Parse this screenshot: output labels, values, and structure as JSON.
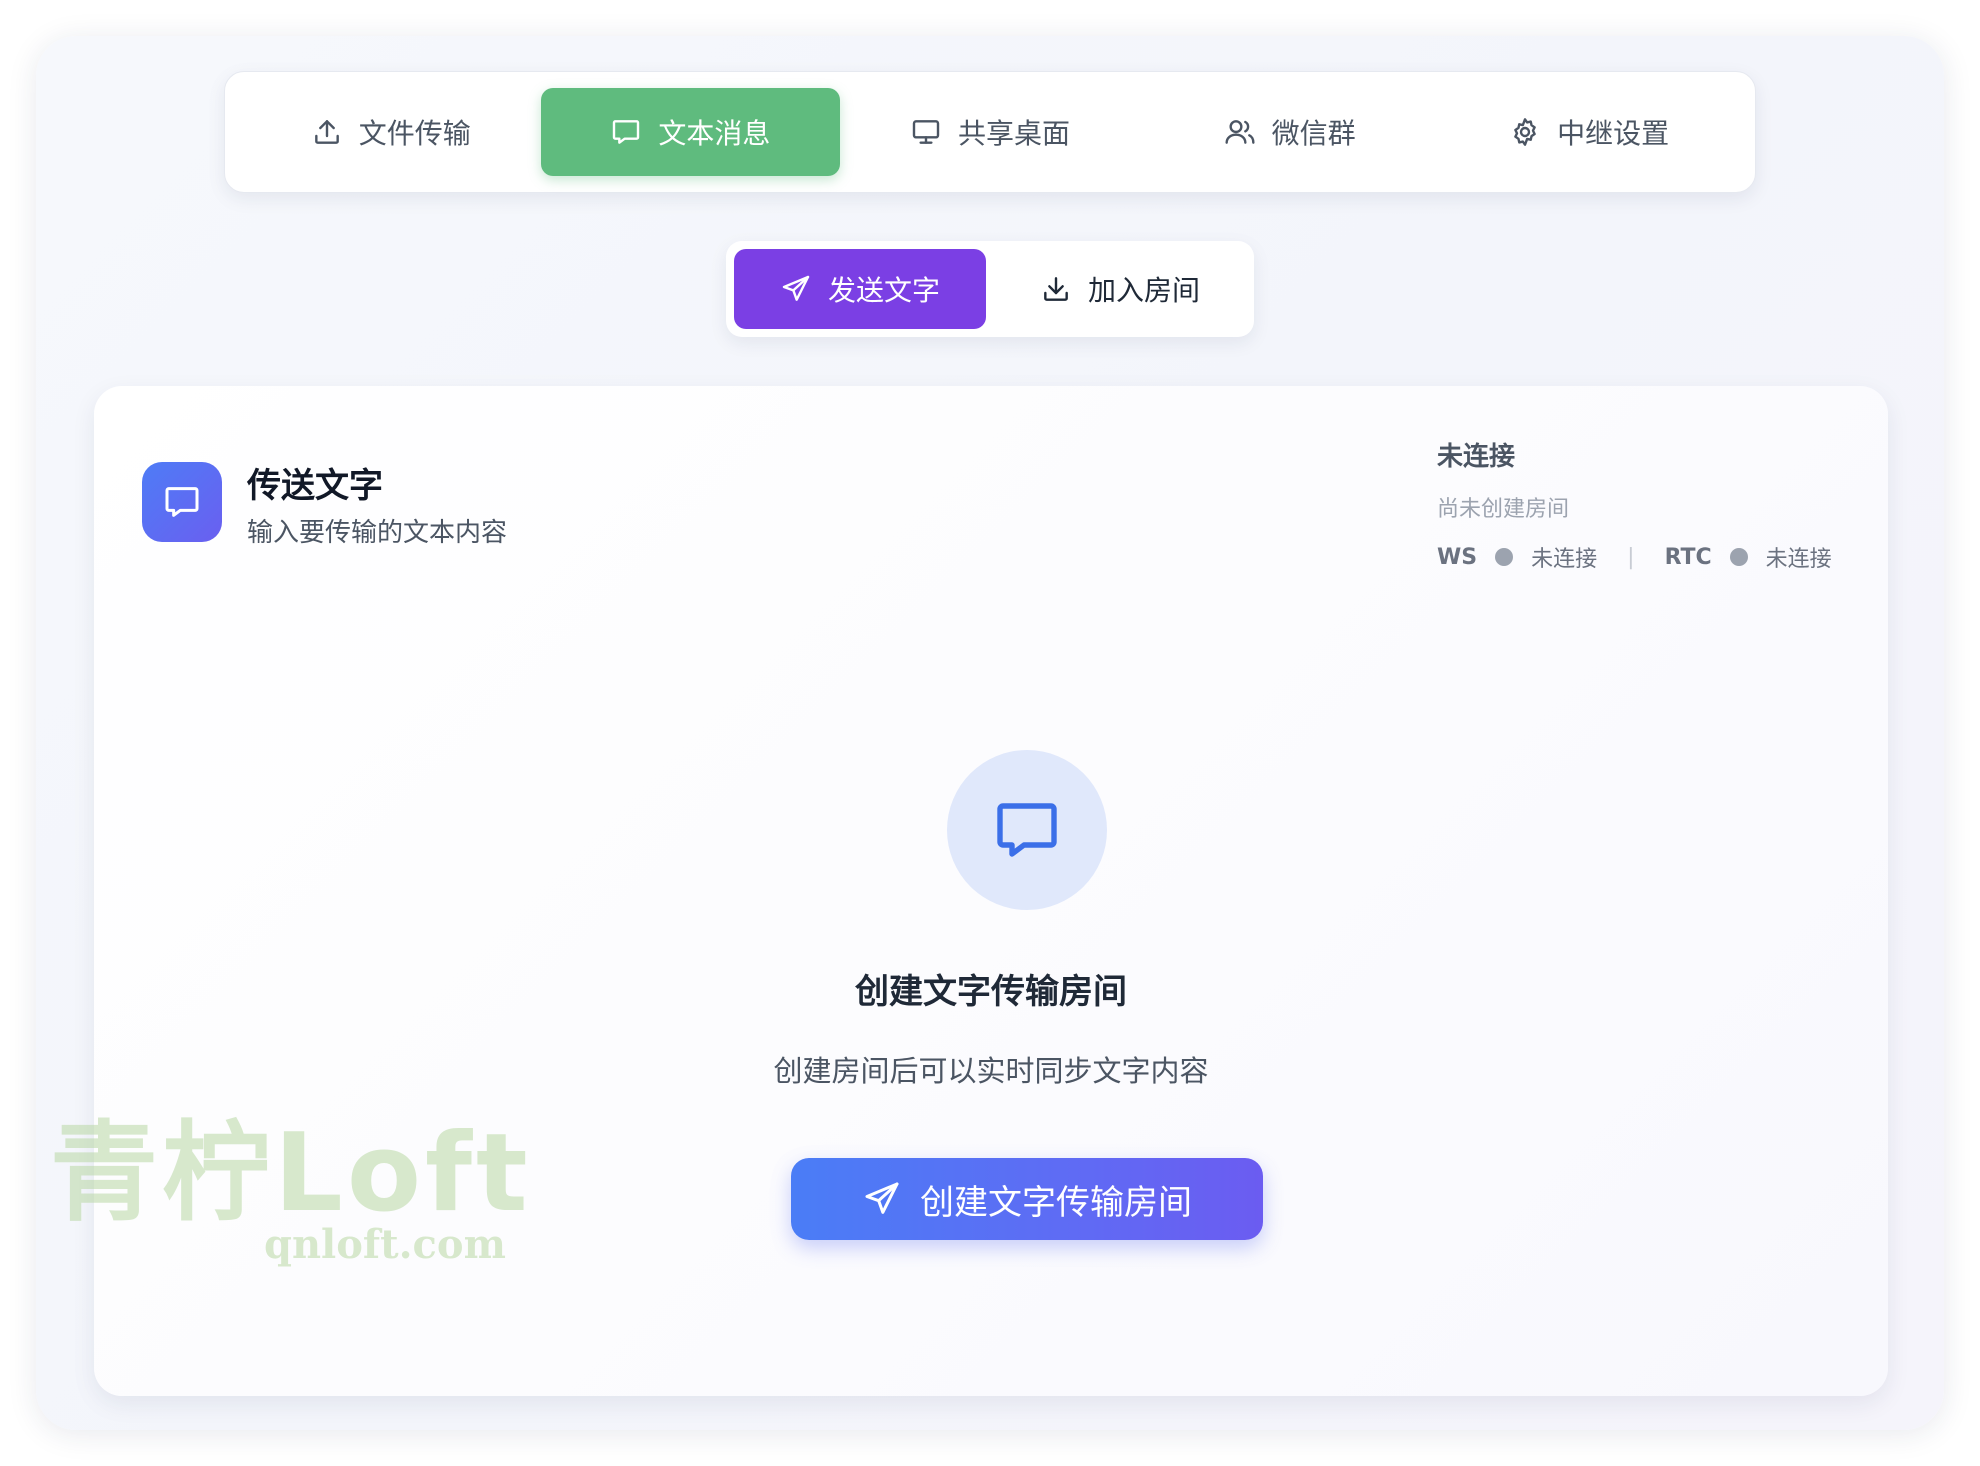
{
  "main_tabs": [
    {
      "label": "文件传输",
      "icon": "upload-icon",
      "active": false
    },
    {
      "label": "文本消息",
      "icon": "message-icon",
      "active": true
    },
    {
      "label": "共享桌面",
      "icon": "monitor-icon",
      "active": false
    },
    {
      "label": "微信群",
      "icon": "users-icon",
      "active": false
    },
    {
      "label": "中继设置",
      "icon": "gear-icon",
      "active": false
    }
  ],
  "sub_tabs": [
    {
      "label": "发送文字",
      "icon": "send-icon",
      "active": true
    },
    {
      "label": "加入房间",
      "icon": "download-icon",
      "active": false
    }
  ],
  "card": {
    "title": "传送文字",
    "subtitle": "输入要传输的文本内容",
    "status": {
      "title": "未连接",
      "room": "尚未创建房间",
      "ws_label": "WS",
      "ws_state": "未连接",
      "separator": "|",
      "rtc_label": "RTC",
      "rtc_state": "未连接"
    },
    "empty": {
      "title": "创建文字传输房间",
      "description": "创建房间后可以实时同步文字内容",
      "button_label": "创建文字传输房间"
    }
  },
  "watermark": {
    "text": "青柠Loft",
    "url": "qnloft.com"
  },
  "colors": {
    "main_tab_active": "#5fbb7e",
    "sub_tab_active": "#7b3fe4",
    "primary_gradient_start": "#4a7df6",
    "primary_gradient_end": "#6b5cf1",
    "status_dot": "#9ca3af"
  }
}
